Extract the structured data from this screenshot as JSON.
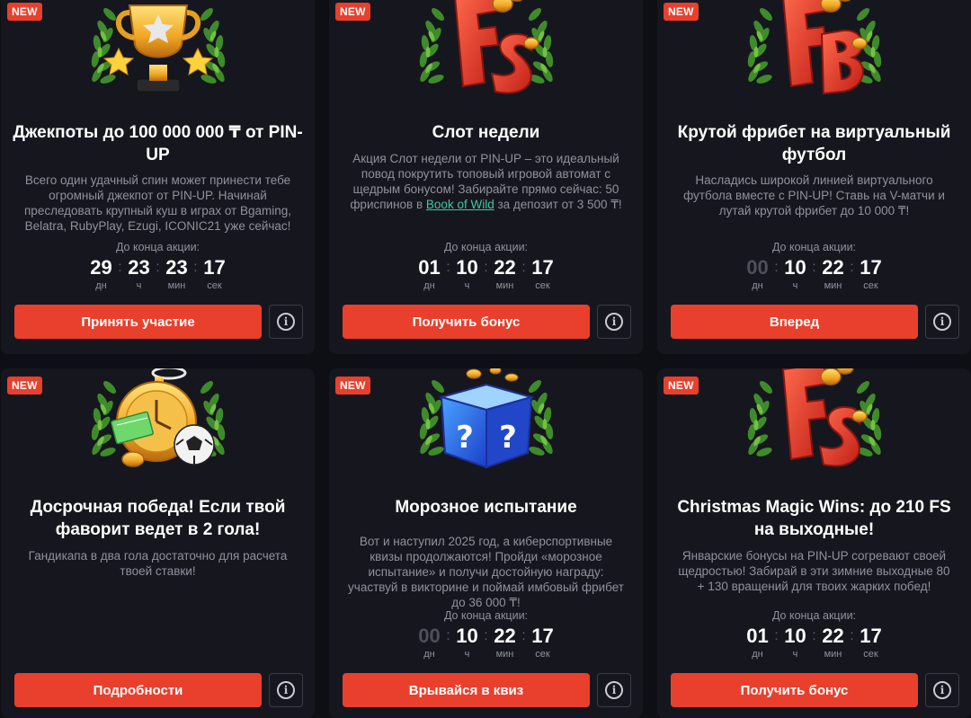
{
  "colors": {
    "accent": "#e8402d",
    "card": "#16171e",
    "page": "#0e0f14",
    "muted": "#8e919c",
    "link": "#3fc8a0"
  },
  "timer_label": "До конца акции:",
  "units": {
    "days": "дн",
    "hours": "ч",
    "minutes": "мин",
    "seconds": "сек"
  },
  "cards": [
    {
      "badge": "NEW",
      "icon": "trophy-icon",
      "title": "Джекпоты до 100 000 000 ₸ от PIN-UP",
      "description": "Всего один удачный спин может принести тебе огромный джекпот от PIN-UP. Начинай преследовать крупный куш в играх от Bgaming, Belatra, RubyPlay, Ezugi, ICONIC21 уже сейчас!",
      "timer": {
        "days": "29",
        "hours": "23",
        "minutes": "23",
        "seconds": "17"
      },
      "button": "Принять участие"
    },
    {
      "badge": "NEW",
      "icon": "free-spins-icon",
      "title": "Слот недели",
      "description_before": "Акция Слот недели от PIN-UP – это идеальный повод покрутить топовый игровой автомат с щедрым бонусом! Забирайте прямо сейчас: 50 фриспинов в",
      "description_link": "Book of Wild",
      "description_after": "за депозит от 3 500 ₸!",
      "timer": {
        "days": "01",
        "hours": "10",
        "minutes": "22",
        "seconds": "17"
      },
      "button": "Получить бонус"
    },
    {
      "badge": "NEW",
      "icon": "freebet-icon",
      "title": "Крутой фрибет на виртуальный футбол",
      "description": "Насладись широкой линией виртуального футбола вместе с PIN-UP! Ставь на V-матчи и лутай крутой фрибет до 10 000 ₸!",
      "timer": {
        "days": "00",
        "hours": "10",
        "minutes": "22",
        "seconds": "17"
      },
      "button": "Вперед"
    },
    {
      "badge": "NEW",
      "icon": "stopwatch-football-icon",
      "title": "Досрочная победа! Если твой фаворит ведет в 2 гола!",
      "description": "Гандикапа в два гола достаточно для расчета твоей ставки!",
      "button": "Подробности"
    },
    {
      "badge": "NEW",
      "icon": "mystery-box-icon",
      "title": "Морозное испытание",
      "description": "Вот и наступил 2025 год, а киберспортивные квизы продолжаются! Пройди «морозное испытание» и получи достойную награду: участвуй в викторине и поймай имбовый фрибет до 36 000 ₸!",
      "timer": {
        "days": "00",
        "hours": "10",
        "minutes": "22",
        "seconds": "17"
      },
      "button": "Врывайся в квиз"
    },
    {
      "badge": "NEW",
      "icon": "free-spins-icon",
      "title": "Christmas Magic Wins: до 210 FS на выходные!",
      "description": "Январские бонусы на PIN-UP согревают своей щедростью! Забирай в эти зимние выходные 80 + 130 вращений для твоих жарких побед!",
      "timer": {
        "days": "01",
        "hours": "10",
        "minutes": "22",
        "seconds": "17"
      },
      "button": "Получить бонус"
    }
  ]
}
